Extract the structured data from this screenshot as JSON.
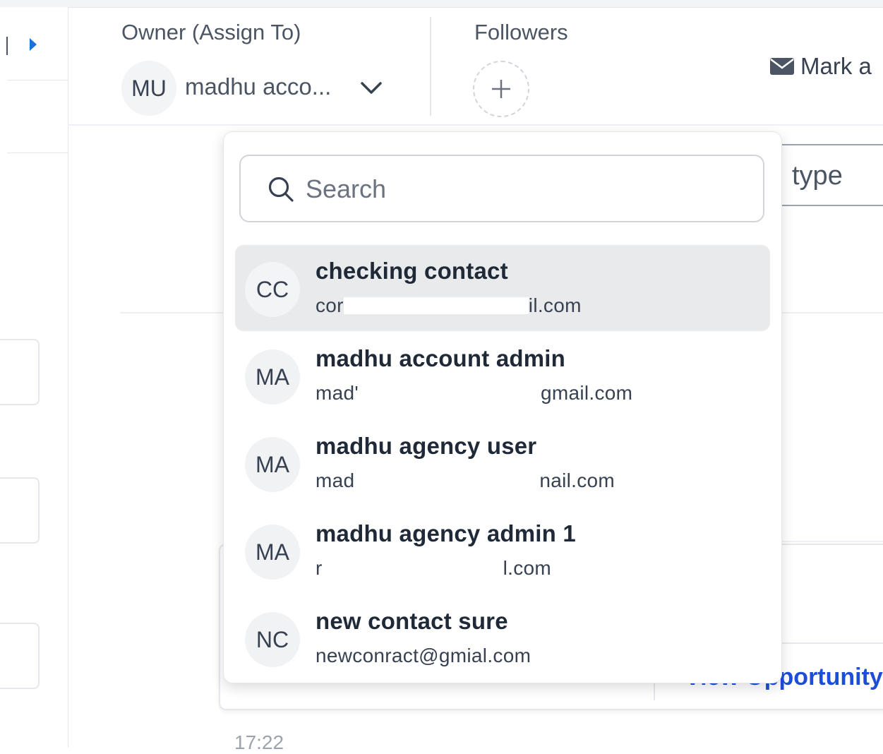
{
  "header": {
    "owner": {
      "label": "Owner (Assign To)",
      "avatar_initials": "MU",
      "name_display": "madhu acco...",
      "chevron_icon": "chevron-down-icon"
    },
    "followers": {
      "label": "Followers",
      "add_icon": "plus-icon"
    },
    "mark_button": {
      "icon": "envelope-icon",
      "label": "Mark a"
    }
  },
  "background": {
    "type_field_text": "type",
    "link_text": "View Opportunity",
    "timestamp": "17:22"
  },
  "dropdown": {
    "search": {
      "icon": "search-icon",
      "placeholder": "Search",
      "value": ""
    },
    "options": [
      {
        "initials": "CC",
        "name": "checking contact",
        "email_visible_start": "cor",
        "email_visible_end": "il.com",
        "highlighted": true
      },
      {
        "initials": "MA",
        "name": "madhu account admin",
        "email_visible_start": "mad'",
        "email_visible_end": "gmail.com",
        "highlighted": false
      },
      {
        "initials": "MA",
        "name": "madhu agency user",
        "email_visible_start": "mad",
        "email_visible_end": "nail.com",
        "highlighted": false
      },
      {
        "initials": "MA",
        "name": "madhu agency admin 1",
        "email_visible_start": "r",
        "email_visible_end": "l.com",
        "highlighted": false
      },
      {
        "initials": "NC",
        "name": "new contact sure",
        "email_visible_start": "newconract@gmial.com",
        "email_visible_end": "",
        "highlighted": false
      }
    ]
  },
  "colors": {
    "accent": "#1e6fd9",
    "link": "#1d4ed8",
    "highlight": "#e9eaec",
    "avatar_bg": "#f1f2f4"
  }
}
